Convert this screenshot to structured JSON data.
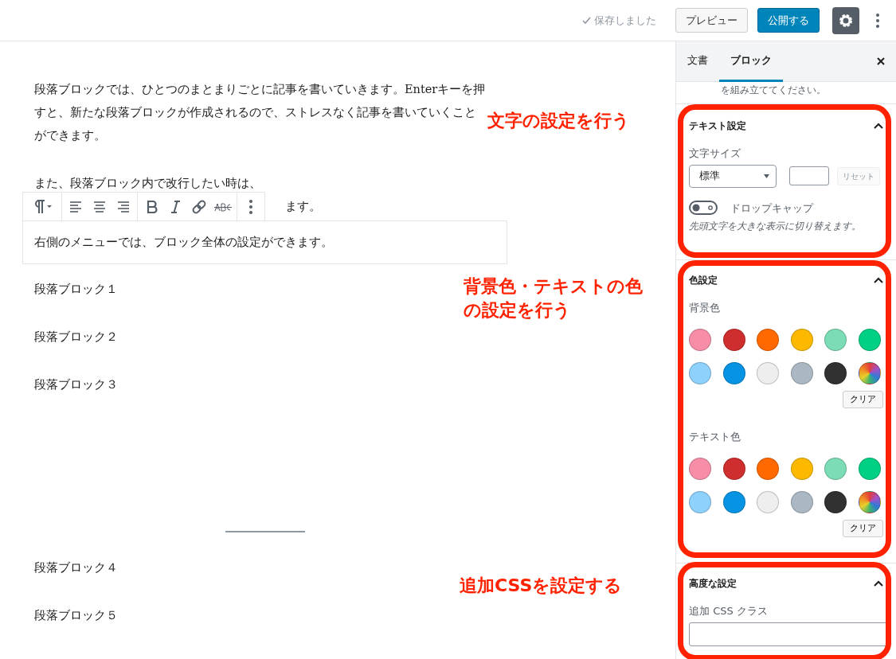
{
  "header": {
    "saved_status": "保存しました",
    "preview_button": "プレビュー",
    "publish_button": "公開する",
    "settings_selected": true
  },
  "editor": {
    "paragraphs": [
      {
        "kind": "text",
        "text": "段落ブロックでは、ひとつのまとまりごとに記事を書いていきます。Enterキーを押すと、新たな段落ブロックが作成されるので、ストレスなく記事を書いていくことができます。"
      },
      {
        "kind": "covered",
        "text": "また、段落ブロック内で改行したい時は、",
        "tail": "ます。"
      },
      {
        "kind": "selected",
        "text": "右側のメニューでは、ブロック全体の設定ができます。"
      },
      {
        "kind": "text",
        "text": "段落ブロック１"
      },
      {
        "kind": "text",
        "text": "段落ブロック２"
      },
      {
        "kind": "text",
        "text": "段落ブロック３"
      },
      {
        "kind": "spacer"
      },
      {
        "kind": "separator"
      },
      {
        "kind": "text",
        "text": "段落ブロック４"
      },
      {
        "kind": "text",
        "text": "段落ブロック５"
      }
    ]
  },
  "sidebar": {
    "tabs": [
      {
        "label": "文書",
        "selected": false
      },
      {
        "label": "ブロック",
        "selected": true
      }
    ],
    "cut_text": "を組み立ててください。",
    "text_settings": {
      "title": "テキスト設定",
      "expanded": true,
      "font_size_label": "文字サイズ",
      "font_size_value": "標準",
      "reset_button": "リセット",
      "drop_cap": {
        "label": "ドロップキャップ",
        "on": false,
        "help": "先頭文字を大きな表示に切り替えます。"
      }
    },
    "color_settings": {
      "title": "色設定",
      "expanded": true,
      "groups": [
        {
          "label": "背景色",
          "clear_button": "クリア",
          "swatches": [
            {
              "kind": "solid",
              "color": "#f78da7"
            },
            {
              "kind": "solid",
              "color": "#cf2e2e"
            },
            {
              "kind": "solid",
              "color": "#ff6900"
            },
            {
              "kind": "solid",
              "color": "#fcb900"
            },
            {
              "kind": "solid",
              "color": "#7bdcb5"
            },
            {
              "kind": "solid",
              "color": "#00d084"
            },
            {
              "kind": "solid",
              "color": "#8ed1fc"
            },
            {
              "kind": "solid",
              "color": "#0693e3"
            },
            {
              "kind": "solid",
              "color": "#eeeeee"
            },
            {
              "kind": "solid",
              "color": "#abb8c3"
            },
            {
              "kind": "solid",
              "color": "#313131"
            },
            {
              "kind": "gradient"
            }
          ]
        },
        {
          "label": "テキスト色",
          "clear_button": "クリア",
          "swatches": [
            {
              "kind": "solid",
              "color": "#f78da7"
            },
            {
              "kind": "solid",
              "color": "#cf2e2e"
            },
            {
              "kind": "solid",
              "color": "#ff6900"
            },
            {
              "kind": "solid",
              "color": "#fcb900"
            },
            {
              "kind": "solid",
              "color": "#7bdcb5"
            },
            {
              "kind": "solid",
              "color": "#00d084"
            },
            {
              "kind": "solid",
              "color": "#8ed1fc"
            },
            {
              "kind": "solid",
              "color": "#0693e3"
            },
            {
              "kind": "solid",
              "color": "#eeeeee"
            },
            {
              "kind": "solid",
              "color": "#abb8c3"
            },
            {
              "kind": "solid",
              "color": "#313131"
            },
            {
              "kind": "gradient"
            }
          ]
        }
      ]
    },
    "advanced_settings": {
      "title": "高度な設定",
      "expanded": true,
      "css_class_label": "追加 CSS クラス"
    }
  },
  "annotations": [
    {
      "text": "文字の設定を行う"
    },
    {
      "text": "背景色・テキストの色の設定を行う"
    },
    {
      "text": "追加CSSを設定する"
    }
  ]
}
